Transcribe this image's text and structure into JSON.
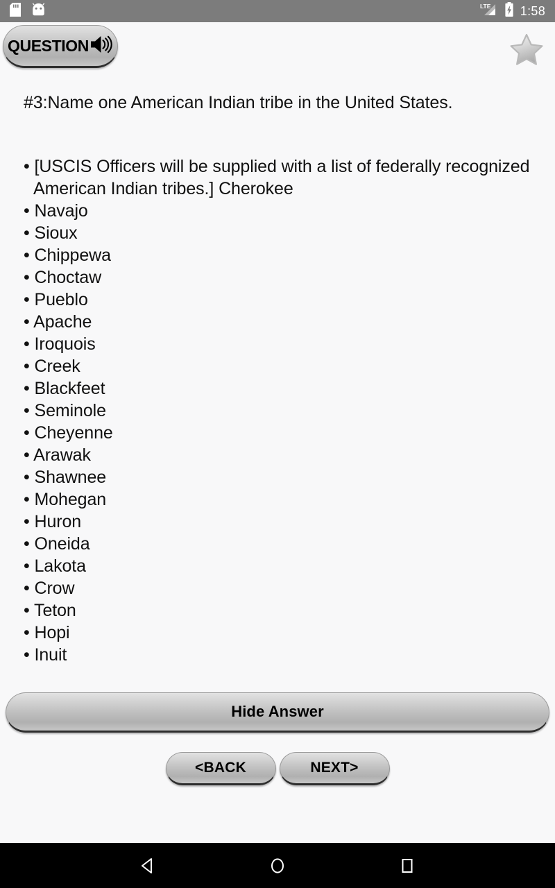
{
  "status_bar": {
    "background_color": "#7c7c7c",
    "left_icons": [
      {
        "name": "sd-card-icon",
        "label": "SD card"
      },
      {
        "name": "android-head-icon",
        "label": "Android system"
      }
    ],
    "network_type": "LTE",
    "right_icons": [
      {
        "name": "lte-signal-icon",
        "label": "LTE signal"
      },
      {
        "name": "battery-charging-icon",
        "label": "Battery charging"
      }
    ],
    "time": "1:58"
  },
  "top_bar": {
    "question_button_label": "QUESTION",
    "speaker_icon": "speaker-volume-icon",
    "favorite_icon": "star-outline-icon",
    "favorite_state": "unselected"
  },
  "content": {
    "question": "#3:Name one American Indian tribe in the United States.",
    "answer_lines": [
      "• [USCIS Officers will be supplied with a list of federally recognized American Indian tribes.] Cherokee",
      "• Navajo",
      "• Sioux",
      "• Chippewa",
      "• Choctaw",
      "• Pueblo",
      "• Apache",
      "• Iroquois",
      "• Creek",
      "• Blackfeet",
      "• Seminole",
      "• Cheyenne",
      "• Arawak",
      "• Shawnee",
      "• Mohegan",
      "• Huron",
      "• Oneida",
      "• Lakota",
      "• Crow",
      "• Teton",
      "• Hopi",
      "• Inuit"
    ]
  },
  "controls": {
    "hide_answer_label": "Hide Answer",
    "back_label": "<BACK",
    "next_label": "NEXT>"
  },
  "android_nav": {
    "back_icon": "triangle-back-icon",
    "home_icon": "circle-home-icon",
    "recents_icon": "square-recents-icon"
  },
  "colors": {
    "status_bar": "#7c7c7c",
    "page_background": "#f8f8f9",
    "text": "#111111",
    "nav_bar": "#000000",
    "button_face": "#c6c6c6"
  }
}
